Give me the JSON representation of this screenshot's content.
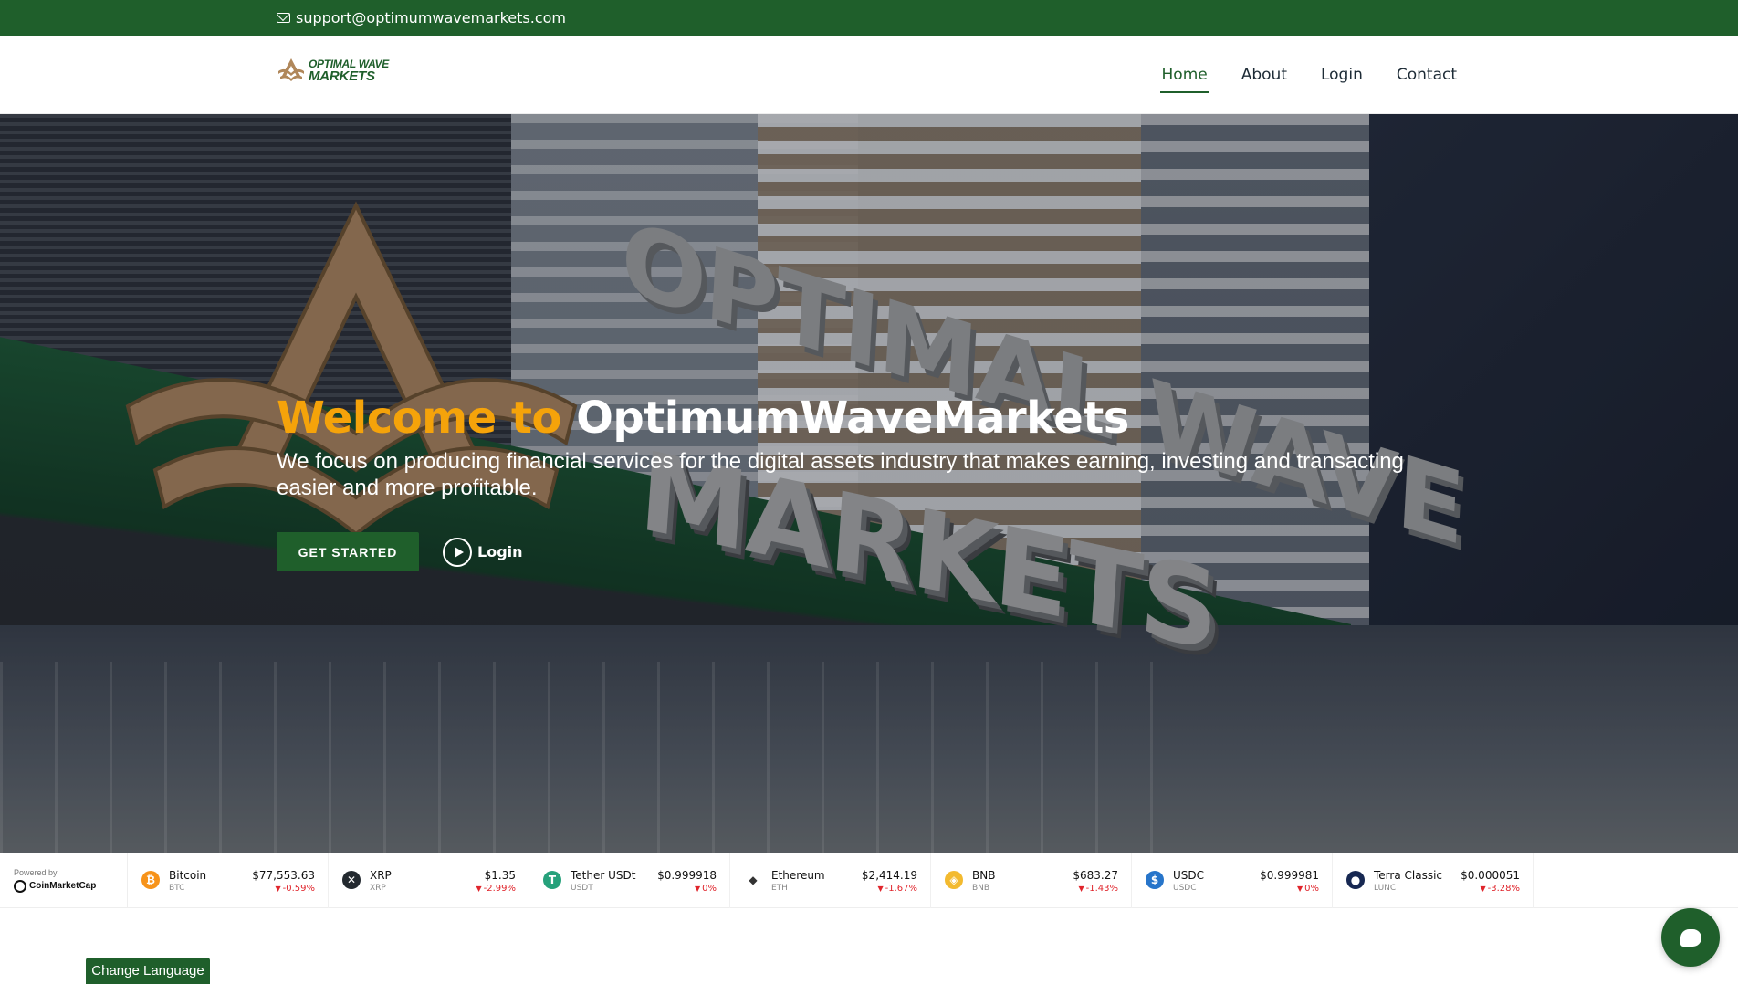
{
  "topbar": {
    "email": "support@optimumwavemarkets.com",
    "email_icon": "envelope-icon"
  },
  "header": {
    "logo_line1": "OPTIMAL WAVE",
    "logo_line2": "MARKETS",
    "nav": [
      {
        "label": "Home",
        "active": true
      },
      {
        "label": "About",
        "active": false
      },
      {
        "label": "Login",
        "active": false
      },
      {
        "label": "Contact",
        "active": false
      }
    ]
  },
  "hero": {
    "title_accent": "Welcome to",
    "title_main": "OptimumWaveMarkets",
    "subtitle": "We focus on producing financial services for the digital assets industry that makes earning, investing and transacting easier and more profitable.",
    "cta_primary": "GET STARTED",
    "cta_secondary": "Login",
    "sign_text_top": "OPTIMAL WAVE",
    "sign_text_bottom": "MARKETS"
  },
  "ticker": {
    "powered_by": "Powered by",
    "provider": "CoinMarketCap",
    "coins": [
      {
        "name": "Bitcoin",
        "symbol": "BTC",
        "price": "$77,553.63",
        "change": "-0.59%",
        "color": "#f7931a",
        "glyph": "₿"
      },
      {
        "name": "XRP",
        "symbol": "XRP",
        "price": "$1.35",
        "change": "-2.99%",
        "color": "#23292f",
        "glyph": "✕"
      },
      {
        "name": "Tether USDt",
        "symbol": "USDT",
        "price": "$0.999918",
        "change": "0%",
        "color": "#26a17b",
        "glyph": "T"
      },
      {
        "name": "Ethereum",
        "symbol": "ETH",
        "price": "$2,414.19",
        "change": "-1.67%",
        "color": "#ffffff",
        "glyph": "◆"
      },
      {
        "name": "BNB",
        "symbol": "BNB",
        "price": "$683.27",
        "change": "-1.43%",
        "color": "#f3ba2f",
        "glyph": "◈"
      },
      {
        "name": "USDC",
        "symbol": "USDC",
        "price": "$0.999981",
        "change": "0%",
        "color": "#2775ca",
        "glyph": "$"
      },
      {
        "name": "Terra Classic",
        "symbol": "LUNC",
        "price": "$0.000051",
        "change": "-3.28%",
        "color": "#172852",
        "glyph": "●"
      }
    ]
  },
  "footer": {
    "language_button": "Change Language"
  },
  "colors": {
    "brand_green": "#1f5f2b",
    "accent_orange": "#f5a30a",
    "negative_red": "#e0252c"
  }
}
